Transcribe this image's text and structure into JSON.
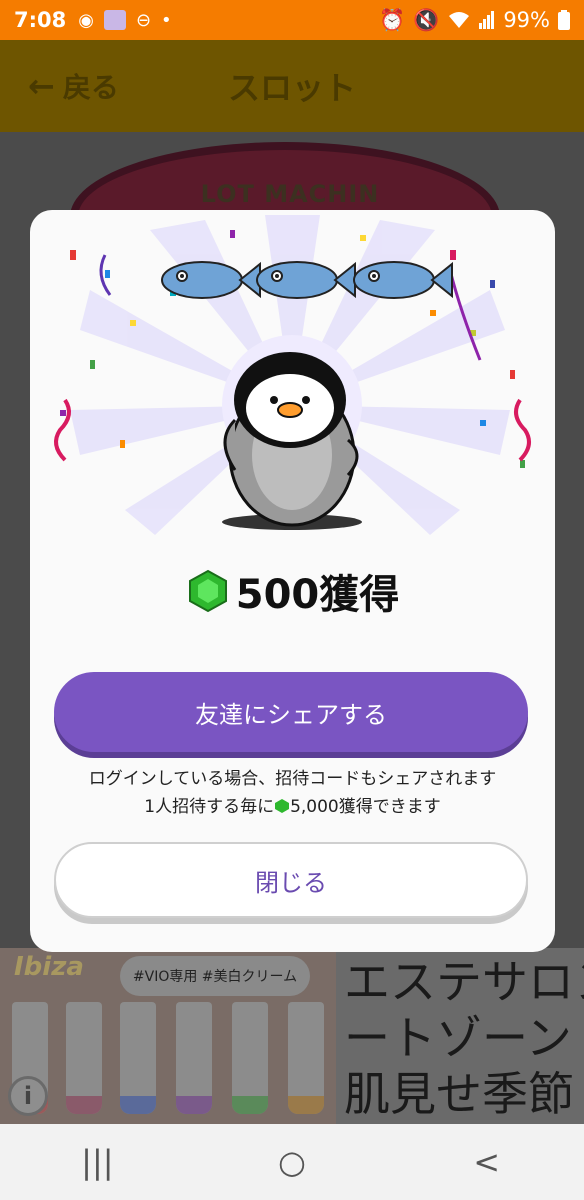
{
  "status_bar": {
    "time": "7:08",
    "battery": "99%",
    "left_icons": [
      "eye-icon",
      "app-icon",
      "dnd-icon",
      "dot-icon"
    ],
    "right_icons": [
      "alarm-icon",
      "mute-icon",
      "wifi-icon",
      "signal-icon",
      "battery-icon"
    ]
  },
  "app_bar": {
    "back_label": "戻る",
    "title": "スロット"
  },
  "background": {
    "slot_sign_text": "LOT MACHIN"
  },
  "modal": {
    "reward_amount": "500獲得",
    "share_button_label": "友達にシェアする",
    "note_line1": "ログインしている場合、招待コードもシェアされます",
    "note_line2_prefix": "1人招待する毎に",
    "note_line2_suffix": "5,000獲得できます",
    "close_button_label": "閉じる",
    "accent_color": "#7a55c2"
  },
  "ad": {
    "brand": "Ibiza",
    "tags": "#VIO専用  #美白クリーム",
    "tube_text": "Ibiza",
    "headline_lines": [
      "エステサロン",
      "ートゾーン",
      "肌見せ季節"
    ]
  },
  "nav_bar": {
    "recent_label": "|||",
    "home_label": "○",
    "back_label": "<"
  }
}
